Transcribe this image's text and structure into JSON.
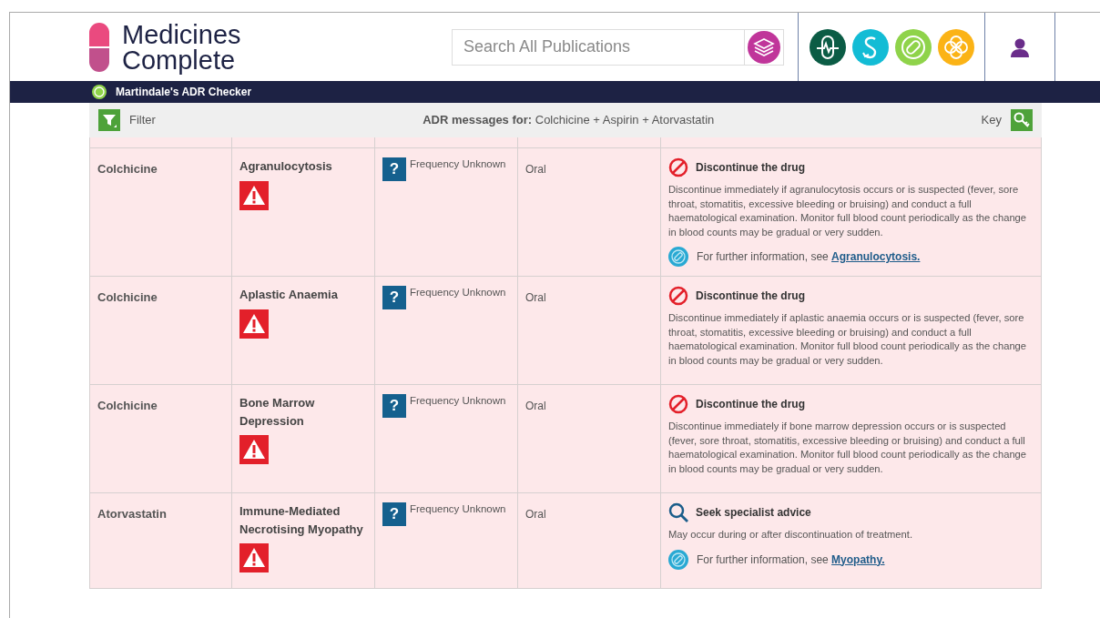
{
  "brand": {
    "line1": "Medicines",
    "line2": "Complete"
  },
  "search": {
    "placeholder": "Search All Publications"
  },
  "product_bar": {
    "title": "Martindale's ADR Checker"
  },
  "toolbar": {
    "filter": "Filter",
    "heading_label": "ADR messages for:",
    "heading_value": "Colchicine + Aspirin + Atorvastatin",
    "key": "Key"
  },
  "rows": [
    {
      "drug": "Colchicine",
      "reaction": "Agranulocytosis",
      "frequency": "Frequency Unknown",
      "route": "Oral",
      "frequency_mark": "?",
      "kind": "discontinue",
      "advice_title": "Discontinue the drug",
      "advice_text": "Discontinue immediately if agranulocytosis occurs or is suspected (fever, sore throat, stomatitis, excessive bleeding or bruising) and conduct a full haematological examination. Monitor full blood count periodically as the change in blood counts may be gradual or very sudden.",
      "info_text": "For further information, see",
      "info_link": "Agranulocytosis."
    },
    {
      "drug": "Colchicine",
      "reaction": "Aplastic Anaemia",
      "frequency": "Frequency Unknown",
      "route": "Oral",
      "frequency_mark": "?",
      "kind": "discontinue",
      "advice_title": "Discontinue the drug",
      "advice_text": "Discontinue immediately if aplastic anaemia occurs or is suspected (fever, sore throat, stomatitis, excessive bleeding or bruising) and conduct a full haematological examination. Monitor full blood count periodically as the change in blood counts may be gradual or very sudden."
    },
    {
      "drug": "Colchicine",
      "reaction": "Bone Marrow Depression",
      "frequency": "Frequency Unknown",
      "route": "Oral",
      "frequency_mark": "?",
      "kind": "discontinue",
      "advice_title": "Discontinue the drug",
      "advice_text": "Discontinue immediately if bone marrow depression occurs or is suspected (fever, sore throat, stomatitis, excessive bleeding or bruising) and conduct a full haematological examination. Monitor full blood count periodically as the change in blood counts may be gradual or very sudden."
    },
    {
      "drug": "Atorvastatin",
      "reaction": "Immune-Mediated Necrotising Myopathy",
      "frequency": "Frequency Unknown",
      "route": "Oral",
      "frequency_mark": "?",
      "kind": "specialist",
      "advice_title": "Seek specialist advice",
      "advice_text": "May occur during or after discontinuation of treatment.",
      "info_text": "For further information, see",
      "info_link": "Myopathy."
    }
  ]
}
